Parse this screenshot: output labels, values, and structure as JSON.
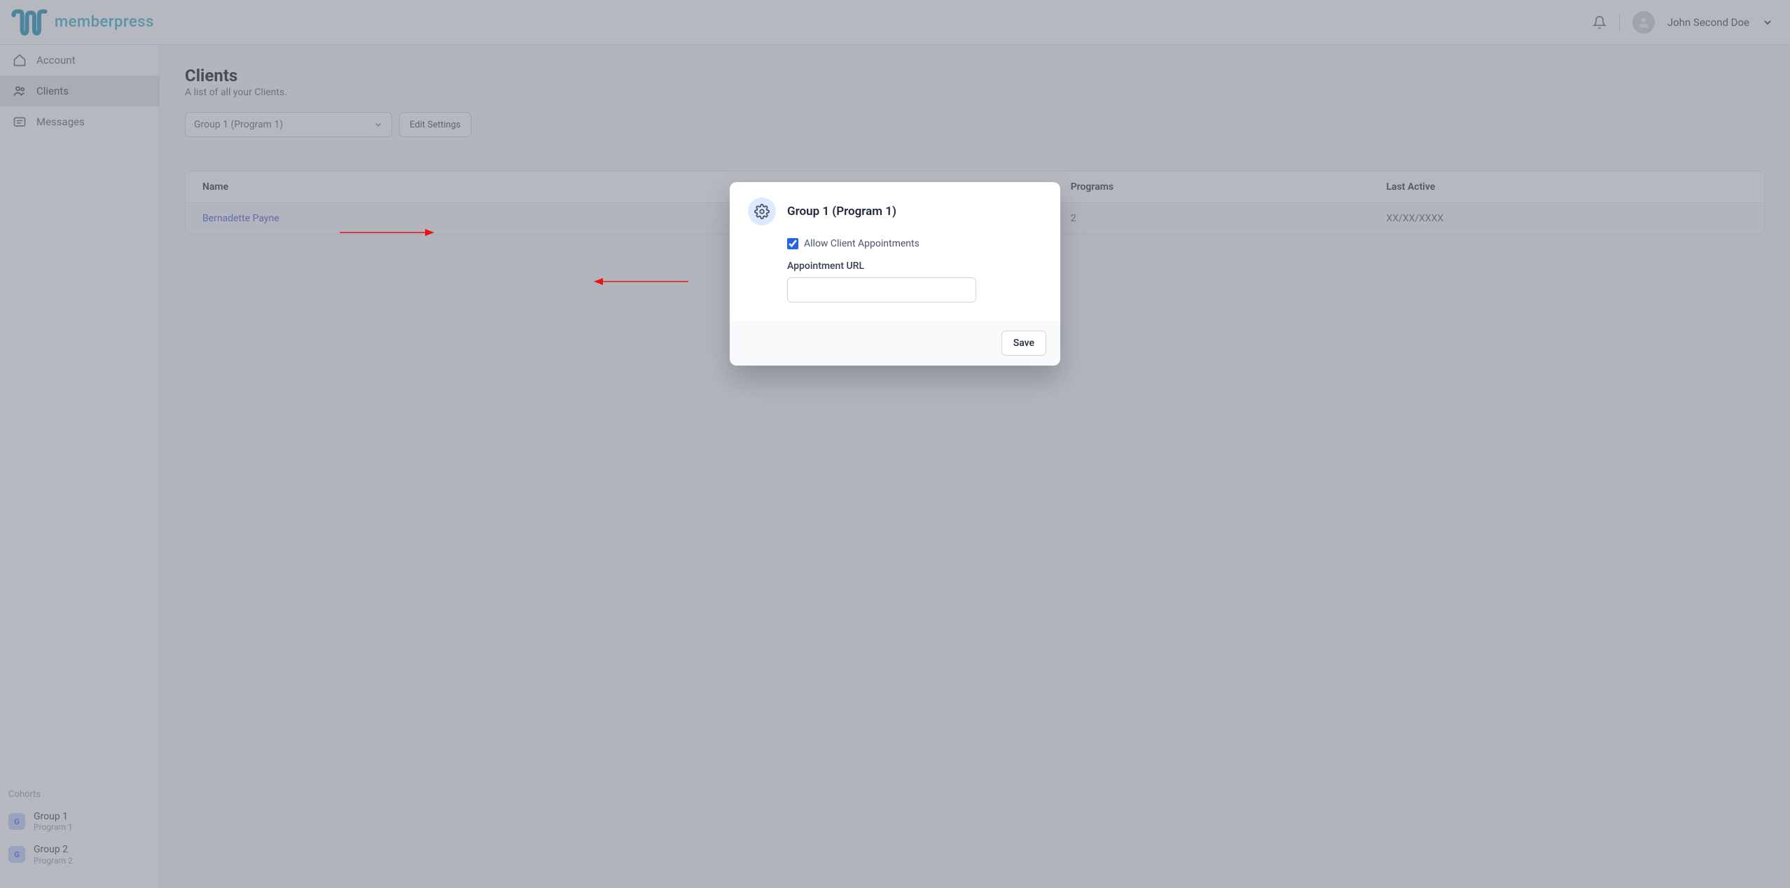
{
  "brand": {
    "name": "memberpress"
  },
  "header": {
    "user_name": "John Second Doe"
  },
  "sidebar": {
    "items": [
      {
        "label": "Account",
        "icon": "home",
        "active": false
      },
      {
        "label": "Clients",
        "icon": "users",
        "active": true
      },
      {
        "label": "Messages",
        "icon": "message",
        "active": false
      }
    ],
    "cohorts_label": "Cohorts",
    "cohorts": [
      {
        "badge": "G",
        "name": "Group 1",
        "program": "Program 1"
      },
      {
        "badge": "G",
        "name": "Group 2",
        "program": "Program 2"
      }
    ]
  },
  "page": {
    "title": "Clients",
    "subtitle": "A list of all your Clients.",
    "group_select_value": "Group 1 (Program 1)",
    "edit_settings_label": "Edit Settings"
  },
  "table": {
    "headers": {
      "name": "Name",
      "programs": "Programs",
      "last_active": "Last Active"
    },
    "rows": [
      {
        "name": "Bernadette Payne",
        "programs": "2",
        "last_active": "XX/XX/XXXX"
      }
    ]
  },
  "modal": {
    "title": "Group 1 (Program 1)",
    "checkbox_label": "Allow Client Appointments",
    "checkbox_checked": true,
    "url_label": "Appointment URL",
    "url_value": "",
    "save_label": "Save"
  }
}
